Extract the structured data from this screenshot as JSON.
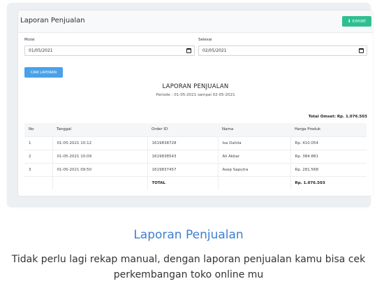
{
  "header": {
    "title": "Laporan Penjualan",
    "export_label": "EXPORT",
    "export_icon": "download-icon"
  },
  "filter": {
    "start_label": "Mulai",
    "start_value": "01/05/2021",
    "end_label": "Selesai",
    "end_value": "02/05/2021",
    "search_label": "CARI LAPORAN"
  },
  "report": {
    "title": "LAPORAN PENJUALAN",
    "period": "Periode : 01-05-2021 sampai 02-05-2021",
    "total_omset": "Total Omset: Rp. 1.076.503",
    "columns": [
      "No",
      "Tanggal",
      "Order ID",
      "Nama",
      "Harga Produk"
    ],
    "rows": [
      [
        "1",
        "01-05-2021 10:12",
        "1619838728",
        "Isa Dahlia",
        "Rp. 410.054"
      ],
      [
        "2",
        "01-05-2021 10:09",
        "1619838543",
        "Ali Akbar",
        "Rp. 384.881"
      ],
      [
        "3",
        "01-05-2021 09:50",
        "1619837457",
        "Asep Saputra",
        "Rp. 281.568"
      ]
    ],
    "total_label": "TOTAL",
    "total_value": "Rp. 1.076.503"
  },
  "feature": {
    "title": "Laporan Penjualan",
    "description": "Tidak perlu lagi rekap manual, dengan laporan penjualan kamu bisa cek perkembangan toko online mu"
  },
  "colors": {
    "export_button": "#2fbf8f",
    "search_button": "#4aa1e8",
    "feature_title": "#3d7fd0"
  }
}
